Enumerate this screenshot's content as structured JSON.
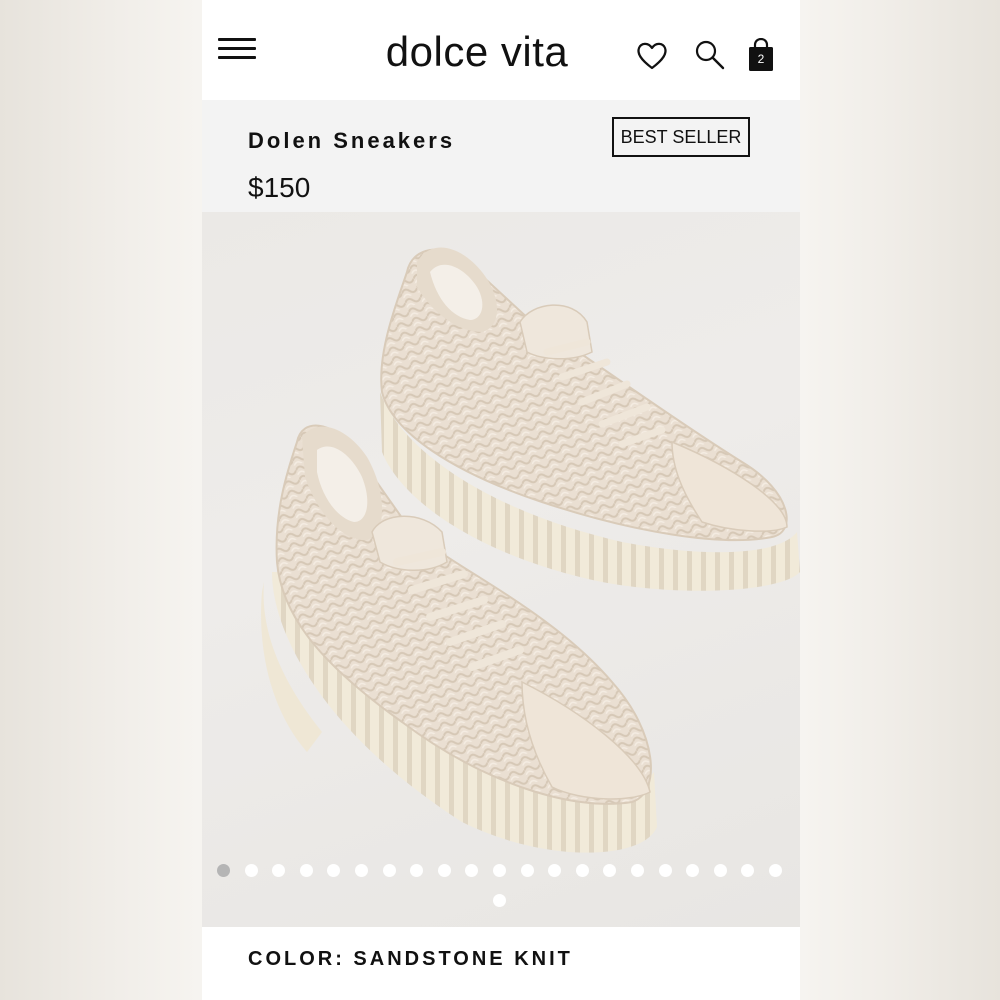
{
  "header": {
    "logo": "dolce vita",
    "menu_icon": "hamburger-menu-icon",
    "wishlist_icon": "heart-icon",
    "search_icon": "search-icon",
    "bag_icon": "shopping-bag-icon",
    "bag_count": "2"
  },
  "product": {
    "name": "Dolen Sneakers",
    "badge": "BEST SELLER",
    "price": "$150",
    "color_label": "COLOR: SANDSTONE KNIT"
  },
  "gallery": {
    "image_count": 22,
    "active_index": 0
  },
  "colors": {
    "text": "#111111",
    "info_background": "#f3f3f3",
    "dot_active": "#b5b5b5",
    "dot_inactive": "#ffffff",
    "sneaker_upper": "#e9ddd0",
    "sneaker_sole": "#f1ead9"
  }
}
